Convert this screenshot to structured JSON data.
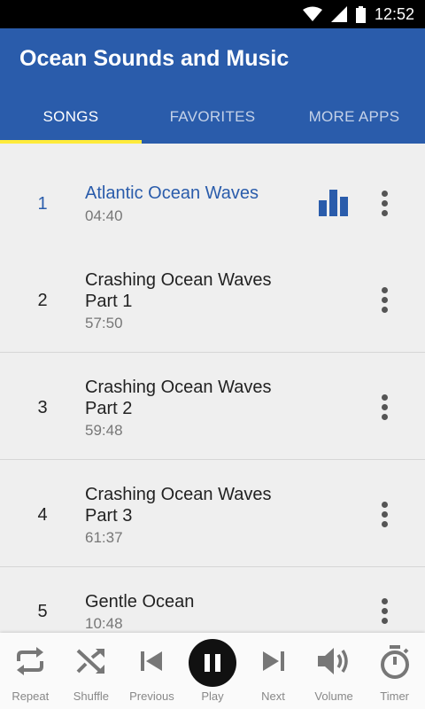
{
  "status": {
    "time": "12:52"
  },
  "app": {
    "title": "Ocean Sounds and Music",
    "accent": "#2a5cab",
    "tab_indicator": "#ffeb3b"
  },
  "tabs": [
    {
      "label": "SONGS",
      "active": true
    },
    {
      "label": "FAVORITES",
      "active": false
    },
    {
      "label": "MORE APPS",
      "active": false
    }
  ],
  "songs": [
    {
      "num": "1",
      "title": "Atlantic Ocean Waves",
      "duration": "04:40",
      "playing": true
    },
    {
      "num": "2",
      "title": "Crashing Ocean Waves Part 1",
      "duration": "57:50"
    },
    {
      "num": "3",
      "title": "Crashing Ocean Waves Part 2",
      "duration": "59:48"
    },
    {
      "num": "4",
      "title": "Crashing Ocean Waves Part 3",
      "duration": "61:37"
    },
    {
      "num": "5",
      "title": "Gentle Ocean",
      "duration": "10:48"
    }
  ],
  "controls": [
    {
      "label": "Repeat",
      "icon": "repeat-icon"
    },
    {
      "label": "Shuffle",
      "icon": "shuffle-icon"
    },
    {
      "label": "Previous",
      "icon": "previous-icon"
    },
    {
      "label": "Play",
      "icon": "pause-icon"
    },
    {
      "label": "Next",
      "icon": "next-icon"
    },
    {
      "label": "Volume",
      "icon": "volume-icon"
    },
    {
      "label": "Timer",
      "icon": "timer-icon"
    }
  ]
}
